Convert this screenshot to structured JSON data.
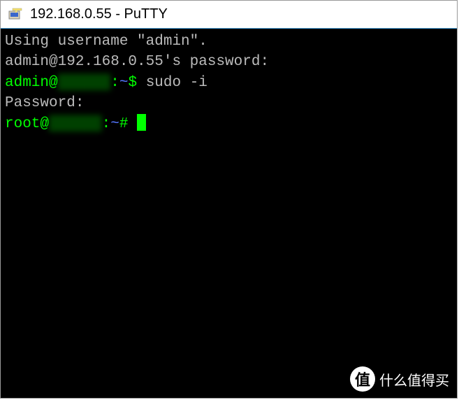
{
  "window": {
    "title": "192.168.0.55 - PuTTY"
  },
  "terminal": {
    "line1": "Using username \"admin\".",
    "line2": "admin@192.168.0.55's password:",
    "prompt1_user": "admin@",
    "prompt1_host_redacted": "██████",
    "prompt1_sep": ":",
    "prompt1_path": "~",
    "prompt1_symbol": "$ ",
    "command1": "sudo -i",
    "line4": "Password:",
    "prompt2_user": "root@",
    "prompt2_host_redacted": "██████",
    "prompt2_sep": ":",
    "prompt2_path": "~",
    "prompt2_symbol": "# "
  },
  "watermark": {
    "badge": "值",
    "text": "什么值得买"
  }
}
